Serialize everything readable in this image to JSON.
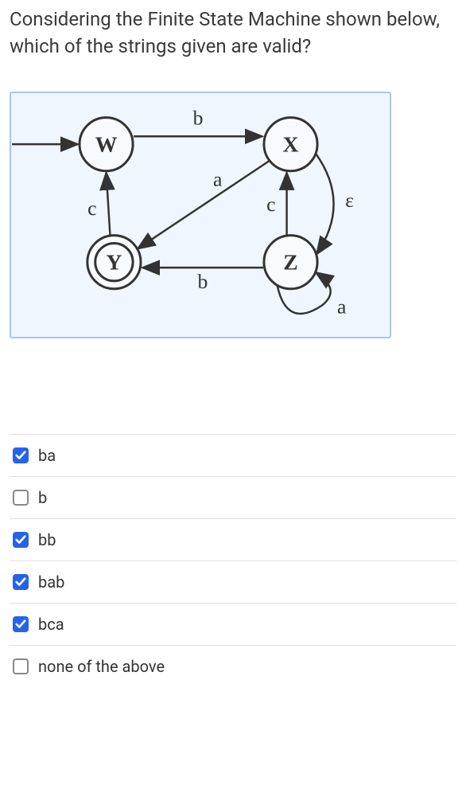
{
  "question": "Considering the Finite State Machine shown below, which of the strings given are valid?",
  "fsm": {
    "states": [
      "W",
      "X",
      "Y",
      "Z"
    ],
    "start_state": "W",
    "accept_states": [
      "Y"
    ],
    "transitions": [
      {
        "from": "W",
        "to": "X",
        "label": "b"
      },
      {
        "from": "X",
        "to": "Y",
        "label": "a"
      },
      {
        "from": "Y",
        "to": "W",
        "label": "c"
      },
      {
        "from": "Z",
        "to": "Y",
        "label": "b"
      },
      {
        "from": "Z",
        "to": "X",
        "label": "c"
      },
      {
        "from": "X",
        "to": "Z",
        "label": "ε"
      },
      {
        "from": "Z",
        "to": "Z",
        "label": "a"
      }
    ]
  },
  "options": [
    {
      "label": "ba",
      "checked": true
    },
    {
      "label": "b",
      "checked": false
    },
    {
      "label": "bb",
      "checked": true
    },
    {
      "label": "bab",
      "checked": true
    },
    {
      "label": "bca",
      "checked": true
    },
    {
      "label": "none of the above",
      "checked": false
    }
  ]
}
